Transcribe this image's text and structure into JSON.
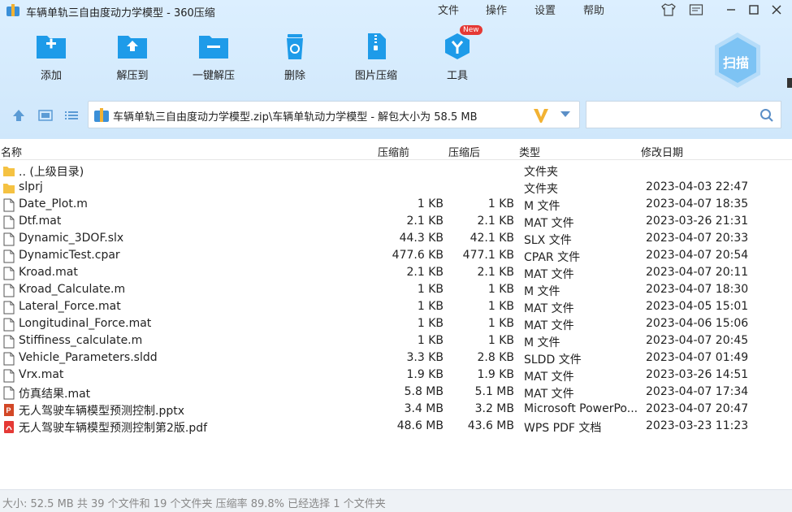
{
  "window": {
    "title": "车辆单轨三自由度动力学模型 - 360压缩",
    "menu": [
      "文件",
      "操作",
      "设置",
      "帮助"
    ]
  },
  "toolbar": {
    "add": "添加",
    "extract_to": "解压到",
    "one_click": "一键解压",
    "delete": "删除",
    "image_compress": "图片压缩",
    "tools": "工具",
    "new_badge": "New",
    "scan": "扫描"
  },
  "address": {
    "path": "车辆单轨三自由度动力学模型.zip\\车辆单轨动力学模型 - 解包大小为 58.5 MB",
    "search_placeholder": ""
  },
  "columns": {
    "name": "名称",
    "compressed_before": "压缩前",
    "compressed_after": "压缩后",
    "type": "类型",
    "modified": "修改日期"
  },
  "files": [
    {
      "icon": "folder-icon",
      "name": ".. (上级目录)",
      "before": "",
      "after": "",
      "type": "文件夹",
      "date": ""
    },
    {
      "icon": "folder-icon",
      "name": "slprj",
      "before": "",
      "after": "",
      "type": "文件夹",
      "date": "2023-04-03 22:47"
    },
    {
      "icon": "file-icon",
      "name": "Date_Plot.m",
      "before": "1 KB",
      "after": "1 KB",
      "type": "M 文件",
      "date": "2023-04-07 18:35"
    },
    {
      "icon": "file-icon",
      "name": "Dtf.mat",
      "before": "2.1 KB",
      "after": "2.1 KB",
      "type": "MAT 文件",
      "date": "2023-03-26 21:31"
    },
    {
      "icon": "file-icon",
      "name": "Dynamic_3DOF.slx",
      "before": "44.3 KB",
      "after": "42.1 KB",
      "type": "SLX 文件",
      "date": "2023-04-07 20:33"
    },
    {
      "icon": "file-icon",
      "name": "DynamicTest.cpar",
      "before": "477.6 KB",
      "after": "477.1 KB",
      "type": "CPAR 文件",
      "date": "2023-04-07 20:54"
    },
    {
      "icon": "file-icon",
      "name": "Kroad.mat",
      "before": "2.1 KB",
      "after": "2.1 KB",
      "type": "MAT 文件",
      "date": "2023-04-07 20:11"
    },
    {
      "icon": "file-icon",
      "name": "Kroad_Calculate.m",
      "before": "1 KB",
      "after": "1 KB",
      "type": "M 文件",
      "date": "2023-04-07 18:30"
    },
    {
      "icon": "file-icon",
      "name": "Lateral_Force.mat",
      "before": "1 KB",
      "after": "1 KB",
      "type": "MAT 文件",
      "date": "2023-04-05 15:01"
    },
    {
      "icon": "file-icon",
      "name": "Longitudinal_Force.mat",
      "before": "1 KB",
      "after": "1 KB",
      "type": "MAT 文件",
      "date": "2023-04-06 15:06"
    },
    {
      "icon": "file-icon",
      "name": "Stiffiness_calculate.m",
      "before": "1 KB",
      "after": "1 KB",
      "type": "M 文件",
      "date": "2023-04-07 20:45"
    },
    {
      "icon": "file-icon",
      "name": "Vehicle_Parameters.sldd",
      "before": "3.3 KB",
      "after": "2.8 KB",
      "type": "SLDD 文件",
      "date": "2023-04-07 01:49"
    },
    {
      "icon": "file-icon",
      "name": "Vrx.mat",
      "before": "1.9 KB",
      "after": "1.9 KB",
      "type": "MAT 文件",
      "date": "2023-03-26 14:51"
    },
    {
      "icon": "file-icon",
      "name": "仿真结果.mat",
      "before": "5.8 MB",
      "after": "5.1 MB",
      "type": "MAT 文件",
      "date": "2023-04-07 17:34"
    },
    {
      "icon": "pptx-icon",
      "name": "无人驾驶车辆模型预测控制.pptx",
      "before": "3.4 MB",
      "after": "3.2 MB",
      "type": "Microsoft PowerPo...",
      "date": "2023-04-07 20:47"
    },
    {
      "icon": "pdf-icon",
      "name": "无人驾驶车辆模型预测控制第2版.pdf",
      "before": "48.6 MB",
      "after": "43.6 MB",
      "type": "WPS PDF 文档",
      "date": "2023-03-23 11:23"
    }
  ],
  "status": "大小: 52.5 MB 共 39 个文件和 19 个文件夹 压缩率 89.8% 已经选择 1 个文件夹",
  "colors": {
    "header_bg": "#d6ecfd",
    "accent_blue": "#1e9be9",
    "new_badge": "#e53935"
  }
}
